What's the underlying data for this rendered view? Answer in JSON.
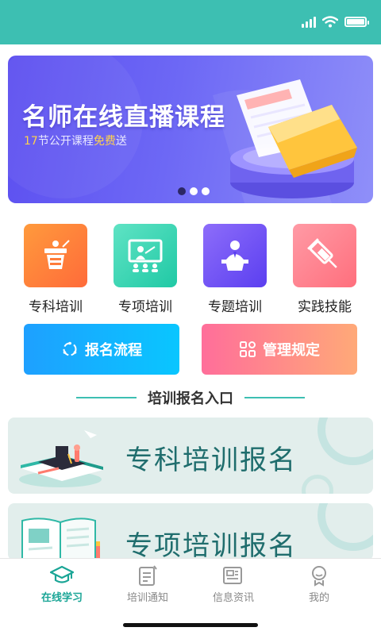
{
  "status_bar": {
    "bg_color": "#3dbfb2",
    "icons": [
      "signal-icon",
      "wifi-icon",
      "battery-icon"
    ],
    "battery_level": 1.0
  },
  "banner": {
    "title": "名师在线直播课程",
    "subtitle_pre": "17",
    "subtitle_mid": "节公开课程",
    "subtitle_hl": "免费",
    "subtitle_post": "送",
    "dots_total": 3,
    "dots_active": 1
  },
  "categories": [
    {
      "label": "专科培训",
      "icon": "lectern-icon",
      "color": "#ff8a3d"
    },
    {
      "label": "专项培训",
      "icon": "classroom-board-icon",
      "color": "#3ed6b6"
    },
    {
      "label": "专题培训",
      "icon": "speaker-podium-icon",
      "color": "#7a5cf5"
    },
    {
      "label": "实践技能",
      "icon": "syringe-icon",
      "color": "#ff7b8a"
    }
  ],
  "actions": {
    "process": {
      "label": "报名流程",
      "icon": "loop-icon"
    },
    "rules": {
      "label": "管理规定",
      "icon": "grid-icon"
    }
  },
  "section": {
    "title": "培训报名入口"
  },
  "cards": [
    {
      "title": "专科培训报名",
      "icon": "graduation-books-illustration"
    },
    {
      "title": "专项培训报名",
      "icon": "open-book-illustration"
    }
  ],
  "tabbar": {
    "accent": "#1aa596",
    "items": [
      {
        "label": "在线学习",
        "icon": "mortarboard-icon",
        "active": true
      },
      {
        "label": "培训通知",
        "icon": "notice-icon",
        "active": false
      },
      {
        "label": "信息资讯",
        "icon": "news-icon",
        "active": false
      },
      {
        "label": "我的",
        "icon": "profile-icon",
        "active": false
      }
    ]
  }
}
